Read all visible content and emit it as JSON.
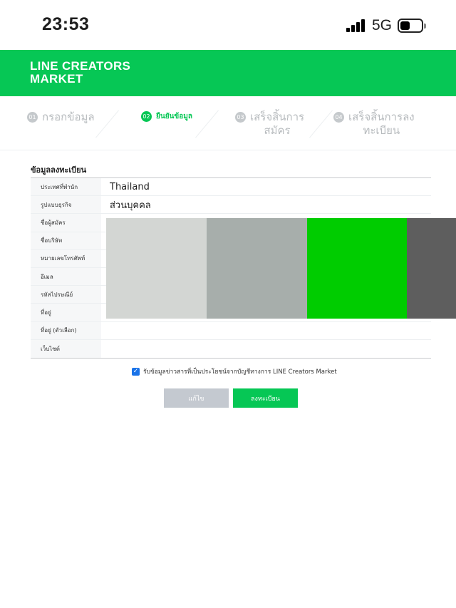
{
  "status_bar": {
    "time": "23:53",
    "network": "5G",
    "icons": [
      "signal-icon",
      "battery-icon"
    ]
  },
  "header": {
    "logo_line1": "LINE CREATORS",
    "logo_line2": "MARKET"
  },
  "steps": [
    {
      "number": "01",
      "label": "กรอกข้อมูล",
      "active": false
    },
    {
      "number": "02",
      "label": "ยืนยันข้อมูล",
      "active": true
    },
    {
      "number": "03",
      "label_line1": "เสร็จสิ้นการ",
      "label_line2": "สมัคร",
      "active": false
    },
    {
      "number": "04",
      "label_line1": "เสร็จสิ้นการลง",
      "label_line2": "ทะเบียน",
      "active": false
    }
  ],
  "section_title": "ข้อมูลลงทะเบียน",
  "table": {
    "rows": [
      {
        "label": "ประเทศที่พำนัก",
        "value": "Thailand"
      },
      {
        "label": "รูปแบบธุรกิจ",
        "value": "ส่วนบุคคล"
      },
      {
        "label": "ชื่อผู้สมัคร",
        "value": ""
      },
      {
        "label": "ชื่อบริษัท",
        "value": ""
      },
      {
        "label": "หมายเลขโทรศัพท์",
        "value": ""
      },
      {
        "label": "อีเมล",
        "value": ""
      },
      {
        "label": "รหัสไปรษณีย์",
        "value": ""
      },
      {
        "label": "ที่อยู่",
        "value": ""
      },
      {
        "label": "ที่อยู่ (ตัวเลือก)",
        "value": ""
      },
      {
        "label": "เว็บไซต์",
        "value": ""
      }
    ]
  },
  "redaction_colors": [
    "#d3d6d3",
    "#a7aeab",
    "#00cc00",
    "#5e5e5e"
  ],
  "consent": {
    "checked": true,
    "text": "รับข้อมูลข่าวสารที่เป็นประโยชน์จากบัญชีทางการ LINE Creators Market"
  },
  "buttons": {
    "edit_label": "แก้ไข",
    "register_label": "ลงทะเบียน"
  },
  "colors": {
    "brand_green": "#06c755",
    "checkbox_blue": "#1a73e8",
    "disabled_button": "#c4c9d0"
  }
}
